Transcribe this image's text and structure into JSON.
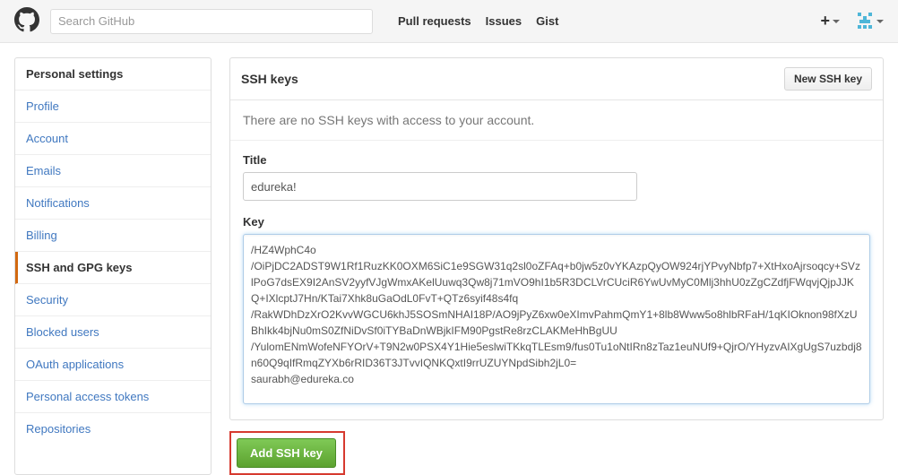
{
  "topbar": {
    "search_placeholder": "Search GitHub",
    "nav": {
      "pulls": "Pull requests",
      "issues": "Issues",
      "gist": "Gist"
    }
  },
  "sidebar": {
    "heading": "Personal settings",
    "items": [
      {
        "label": "Profile",
        "active": false
      },
      {
        "label": "Account",
        "active": false
      },
      {
        "label": "Emails",
        "active": false
      },
      {
        "label": "Notifications",
        "active": false
      },
      {
        "label": "Billing",
        "active": false
      },
      {
        "label": "SSH and GPG keys",
        "active": true
      },
      {
        "label": "Security",
        "active": false
      },
      {
        "label": "Blocked users",
        "active": false
      },
      {
        "label": "OAuth applications",
        "active": false
      },
      {
        "label": "Personal access tokens",
        "active": false
      },
      {
        "label": "Repositories",
        "active": false
      }
    ]
  },
  "panel": {
    "title": "SSH keys",
    "new_button": "New SSH key",
    "empty_message": "There are no SSH keys with access to your account.",
    "form": {
      "title_label": "Title",
      "title_value": "edureka!",
      "key_label": "Key",
      "key_value": "/HZ4WphC4o\n/OiPjDC2ADST9W1Rf1RuzKK0OXM6SiC1e9SGW31q2sl0oZFAq+b0jw5z0vYKAzpQyOW924rjYPvyNbfp7+XtHxoAjrsoqcy+SVzlPoG7dsEX9I2AnSV2yyfVJgWmxAKelUuwq3Qw8j71mVO9hI1b5R3DCLVrCUciR6YwUvMyC0Mlj3hhU0zZgCZdfjFWqvjQjpJJKQ+IXlcptJ7Hn/KTai7Xhk8uGaOdL0FvT+QTz6syif48s4fq\n/RakWDhDzXrO2KvvWGCU6khJ5SOSmNHAI18P/AO9jPyZ6xw0eXImvPahmQmY1+8lb8Www5o8hlbRFaH/1qKIOknon98fXzUBhIkk4bjNu0mS0ZfNiDvSf0iTYBaDnWBjkIFM90PgstRe8rzCLAKMeHhBgUU\n/YulomENmWofeNFYOrV+T9N2w0PSX4Y1Hie5eslwiTKkqTLEsm9/fus0Tu1oNtIRn8zTaz1euNUf9+QjrO/YHyzvAIXgUgS7uzbdj8n60Q9qIfRmqZYXb6rRID36T3JTvvIQNKQxtI9rrUZUYNpdSibh2jL0=\nsaurabh@edureka.co",
      "submit_label": "Add SSH key"
    }
  }
}
